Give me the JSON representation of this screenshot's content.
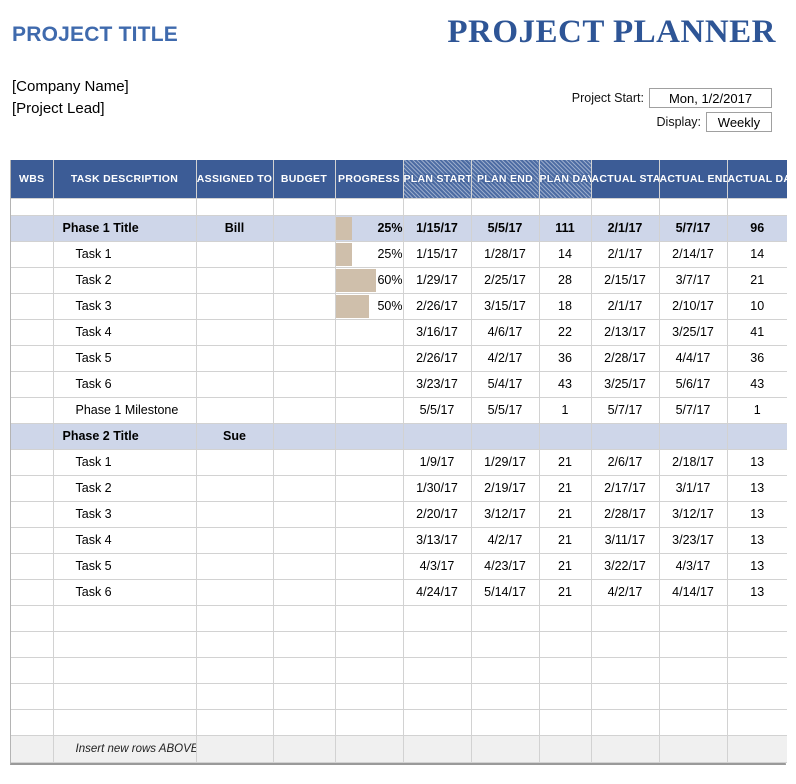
{
  "header": {
    "project_title": "PROJECT TITLE",
    "planner_title": "PROJECT PLANNER",
    "company_name": "[Company Name]",
    "project_lead": "[Project Lead]",
    "project_start_label": "Project Start:",
    "project_start_value": "Mon, 1/2/2017",
    "display_label": "Display:",
    "display_value": "Weekly",
    "accent_title_color": "#3f6aad",
    "accent_planner_color": "#2e5596"
  },
  "table": {
    "columns": [
      {
        "key": "wbs",
        "label": "WBS",
        "hatch": false
      },
      {
        "key": "task",
        "label": "TASK DESCRIPTION",
        "hatch": false
      },
      {
        "key": "assigned",
        "label": "ASSIGNED TO",
        "hatch": false
      },
      {
        "key": "budget",
        "label": "BUDGET",
        "hatch": false
      },
      {
        "key": "progress",
        "label": "PROGRESS",
        "hatch": false
      },
      {
        "key": "plan_start",
        "label": "PLAN START",
        "hatch": true
      },
      {
        "key": "plan_end",
        "label": "PLAN END",
        "hatch": true
      },
      {
        "key": "plan_days",
        "label": "PLAN DAYS",
        "hatch": true
      },
      {
        "key": "actual_start",
        "label": "ACTUAL START",
        "hatch": false
      },
      {
        "key": "actual_end",
        "label": "ACTUAL END",
        "hatch": false
      },
      {
        "key": "actual_days",
        "label": "ACTUAL DAYS",
        "hatch": false
      }
    ],
    "colors": {
      "header_blue": "#3c5c96",
      "phase_row_blue": "#ced6e9",
      "progress_bar_tan": "#cfbfab",
      "footer_gray": "#f0f0f0",
      "grid_line": "#d2d2d2"
    },
    "rows": [
      {
        "type": "spacer",
        "wbs": "",
        "task": "",
        "assigned": "",
        "budget": "",
        "progress": null,
        "plan_start": "",
        "plan_end": "",
        "plan_days": "",
        "actual_start": "",
        "actual_end": "",
        "actual_days": ""
      },
      {
        "type": "phase",
        "wbs": "",
        "task": "Phase 1 Title",
        "assigned": "Bill",
        "budget": "",
        "progress": {
          "label": "25%",
          "value": 25
        },
        "plan_start": "1/15/17",
        "plan_end": "5/5/17",
        "plan_days": "111",
        "actual_start": "2/1/17",
        "actual_end": "5/7/17",
        "actual_days": "96"
      },
      {
        "type": "task",
        "wbs": "",
        "task": "Task 1",
        "assigned": "",
        "budget": "",
        "progress": {
          "label": "25%",
          "value": 25
        },
        "plan_start": "1/15/17",
        "plan_end": "1/28/17",
        "plan_days": "14",
        "actual_start": "2/1/17",
        "actual_end": "2/14/17",
        "actual_days": "14"
      },
      {
        "type": "task",
        "wbs": "",
        "task": "Task 2",
        "assigned": "",
        "budget": "",
        "progress": {
          "label": "60%",
          "value": 60
        },
        "plan_start": "1/29/17",
        "plan_end": "2/25/17",
        "plan_days": "28",
        "actual_start": "2/15/17",
        "actual_end": "3/7/17",
        "actual_days": "21"
      },
      {
        "type": "task",
        "wbs": "",
        "task": "Task 3",
        "assigned": "",
        "budget": "",
        "progress": {
          "label": "50%",
          "value": 50
        },
        "plan_start": "2/26/17",
        "plan_end": "3/15/17",
        "plan_days": "18",
        "actual_start": "2/1/17",
        "actual_end": "2/10/17",
        "actual_days": "10"
      },
      {
        "type": "task",
        "wbs": "",
        "task": "Task 4",
        "assigned": "",
        "budget": "",
        "progress": null,
        "plan_start": "3/16/17",
        "plan_end": "4/6/17",
        "plan_days": "22",
        "actual_start": "2/13/17",
        "actual_end": "3/25/17",
        "actual_days": "41"
      },
      {
        "type": "task",
        "wbs": "",
        "task": "Task 5",
        "assigned": "",
        "budget": "",
        "progress": null,
        "plan_start": "2/26/17",
        "plan_end": "4/2/17",
        "plan_days": "36",
        "actual_start": "2/28/17",
        "actual_end": "4/4/17",
        "actual_days": "36"
      },
      {
        "type": "task",
        "wbs": "",
        "task": "Task 6",
        "assigned": "",
        "budget": "",
        "progress": null,
        "plan_start": "3/23/17",
        "plan_end": "5/4/17",
        "plan_days": "43",
        "actual_start": "3/25/17",
        "actual_end": "5/6/17",
        "actual_days": "43"
      },
      {
        "type": "task",
        "wbs": "",
        "task": "Phase 1 Milestone",
        "assigned": "",
        "budget": "",
        "progress": null,
        "plan_start": "5/5/17",
        "plan_end": "5/5/17",
        "plan_days": "1",
        "actual_start": "5/7/17",
        "actual_end": "5/7/17",
        "actual_days": "1"
      },
      {
        "type": "phase",
        "wbs": "",
        "task": "Phase 2 Title",
        "assigned": "Sue",
        "budget": "",
        "progress": null,
        "plan_start": "",
        "plan_end": "",
        "plan_days": "",
        "actual_start": "",
        "actual_end": "",
        "actual_days": ""
      },
      {
        "type": "task",
        "wbs": "",
        "task": "Task 1",
        "assigned": "",
        "budget": "",
        "progress": null,
        "plan_start": "1/9/17",
        "plan_end": "1/29/17",
        "plan_days": "21",
        "actual_start": "2/6/17",
        "actual_end": "2/18/17",
        "actual_days": "13"
      },
      {
        "type": "task",
        "wbs": "",
        "task": "Task 2",
        "assigned": "",
        "budget": "",
        "progress": null,
        "plan_start": "1/30/17",
        "plan_end": "2/19/17",
        "plan_days": "21",
        "actual_start": "2/17/17",
        "actual_end": "3/1/17",
        "actual_days": "13"
      },
      {
        "type": "task",
        "wbs": "",
        "task": "Task 3",
        "assigned": "",
        "budget": "",
        "progress": null,
        "plan_start": "2/20/17",
        "plan_end": "3/12/17",
        "plan_days": "21",
        "actual_start": "2/28/17",
        "actual_end": "3/12/17",
        "actual_days": "13"
      },
      {
        "type": "task",
        "wbs": "",
        "task": "Task 4",
        "assigned": "",
        "budget": "",
        "progress": null,
        "plan_start": "3/13/17",
        "plan_end": "4/2/17",
        "plan_days": "21",
        "actual_start": "3/11/17",
        "actual_end": "3/23/17",
        "actual_days": "13"
      },
      {
        "type": "task",
        "wbs": "",
        "task": "Task 5",
        "assigned": "",
        "budget": "",
        "progress": null,
        "plan_start": "4/3/17",
        "plan_end": "4/23/17",
        "plan_days": "21",
        "actual_start": "3/22/17",
        "actual_end": "4/3/17",
        "actual_days": "13"
      },
      {
        "type": "task",
        "wbs": "",
        "task": "Task 6",
        "assigned": "",
        "budget": "",
        "progress": null,
        "plan_start": "4/24/17",
        "plan_end": "5/14/17",
        "plan_days": "21",
        "actual_start": "4/2/17",
        "actual_end": "4/14/17",
        "actual_days": "13"
      },
      {
        "type": "task",
        "wbs": "",
        "task": "",
        "assigned": "",
        "budget": "",
        "progress": null,
        "plan_start": "",
        "plan_end": "",
        "plan_days": "",
        "actual_start": "",
        "actual_end": "",
        "actual_days": ""
      },
      {
        "type": "task",
        "wbs": "",
        "task": "",
        "assigned": "",
        "budget": "",
        "progress": null,
        "plan_start": "",
        "plan_end": "",
        "plan_days": "",
        "actual_start": "",
        "actual_end": "",
        "actual_days": ""
      },
      {
        "type": "task",
        "wbs": "",
        "task": "",
        "assigned": "",
        "budget": "",
        "progress": null,
        "plan_start": "",
        "plan_end": "",
        "plan_days": "",
        "actual_start": "",
        "actual_end": "",
        "actual_days": ""
      },
      {
        "type": "task",
        "wbs": "",
        "task": "",
        "assigned": "",
        "budget": "",
        "progress": null,
        "plan_start": "",
        "plan_end": "",
        "plan_days": "",
        "actual_start": "",
        "actual_end": "",
        "actual_days": ""
      },
      {
        "type": "task",
        "wbs": "",
        "task": "",
        "assigned": "",
        "budget": "",
        "progress": null,
        "plan_start": "",
        "plan_end": "",
        "plan_days": "",
        "actual_start": "",
        "actual_end": "",
        "actual_days": ""
      },
      {
        "type": "footer",
        "wbs": "",
        "task": "Insert new rows ABOVE this one",
        "assigned": "",
        "budget": "",
        "progress": null,
        "plan_start": "",
        "plan_end": "",
        "plan_days": "",
        "actual_start": "",
        "actual_end": "",
        "actual_days": ""
      }
    ]
  }
}
